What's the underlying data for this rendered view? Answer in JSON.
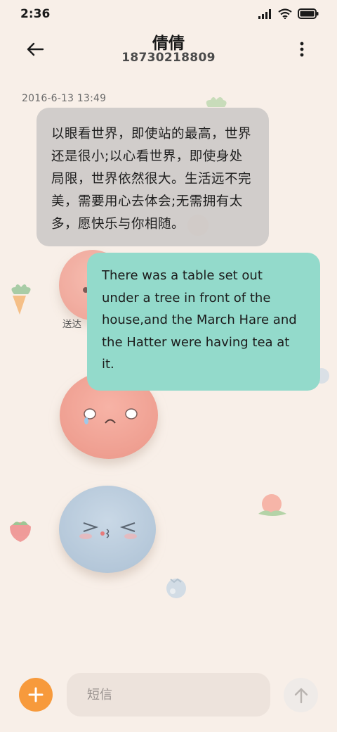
{
  "status_bar": {
    "time": "2:36",
    "icons": [
      "signal-icon",
      "wifi-icon",
      "battery-icon"
    ]
  },
  "header": {
    "back_icon": "arrow-left-icon",
    "contact_name": "倩倩",
    "contact_number": "18730218809",
    "more_icon": "more-vertical-icon"
  },
  "conversation": {
    "timestamp": "2016-6-13 13:49",
    "incoming": {
      "lines": [
        "以眼看世界，即使站的最高，世界",
        "还是很小;以心看世界，即使身处",
        "局限，世界依然很大。生活远不完",
        "美，需要用心去体会;无需拥有太",
        "多，愿快乐与你相随。"
      ]
    },
    "outgoing": {
      "lines": [
        "There was a table set out",
        "under a tree in front of the",
        "house,and the March Hare and",
        "the Hatter were having tea at",
        "it."
      ],
      "status": "送达"
    }
  },
  "input_bar": {
    "add_icon": "plus-icon",
    "placeholder": "短信",
    "value": "",
    "send_icon": "arrow-up-icon"
  },
  "colors": {
    "background": "#f8efe8",
    "incoming_bubble": "#cdcac8",
    "outgoing_bubble": "#93dacb",
    "accent": "#f79a3c"
  }
}
